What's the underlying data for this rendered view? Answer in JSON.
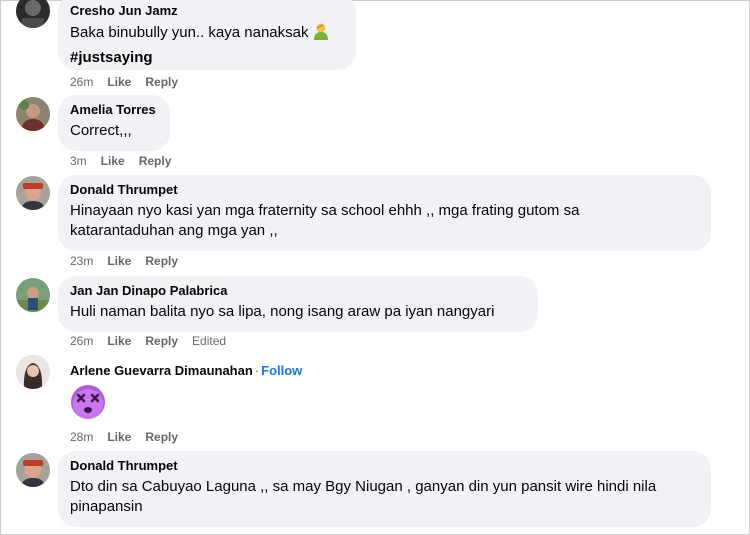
{
  "comments": [
    {
      "author": "Cresho Jun Jamz",
      "text": "Baka binubully yun.. kaya nanaksak",
      "hashtag": "#justsaying",
      "emoji": "person-facepalming-icon",
      "time": "26m",
      "like": "Like",
      "reply": "Reply"
    },
    {
      "author": "Amelia Torres",
      "text": "Correct,,,",
      "time": "3m",
      "like": "Like",
      "reply": "Reply"
    },
    {
      "author": "Donald Thrumpet",
      "text": "Hinayaan nyo kasi yan mga fraternity sa school ehhh ,, mga frating gutom sa katarantaduhan ang mga yan ,,",
      "time": "23m",
      "like": "Like",
      "reply": "Reply"
    },
    {
      "author": "Jan Jan Dinapo Palabrica",
      "text": "Huli naman balita nyo sa lipa, nong isang araw pa iyan nangyari",
      "time": "26m",
      "like": "Like",
      "reply": "Reply",
      "edited": "Edited"
    },
    {
      "author": "Arlene Guevarra Dimaunahan",
      "follow": "Follow",
      "separator": "·",
      "emoji": "dizzy-face-emoji-icon",
      "time": "28m",
      "like": "Like",
      "reply": "Reply"
    },
    {
      "author": "Donald Thrumpet",
      "text": "Dto din sa Cabuyao Laguna ,, sa may Bgy Niugan , ganyan din yun pansit wire hindi nila pinapansin",
      "time": "",
      "like": "",
      "reply": ""
    }
  ],
  "colors": {
    "bubble": "#f0f2f5",
    "secondary_text": "#65676b",
    "link": "#1b74e4"
  }
}
